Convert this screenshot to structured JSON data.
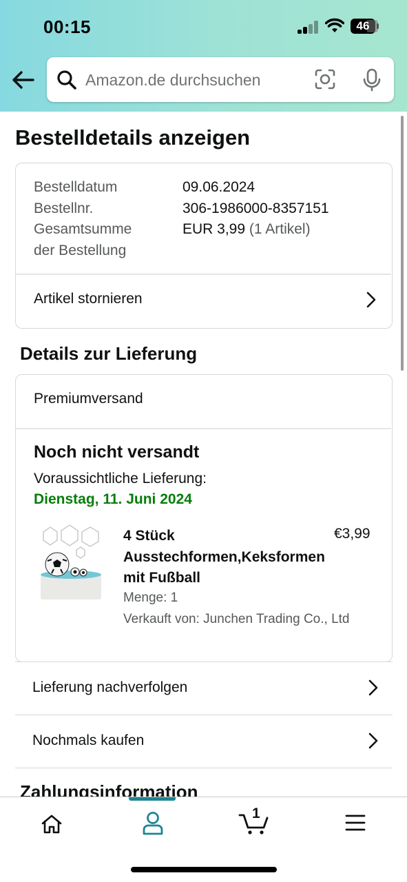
{
  "status_bar": {
    "time": "00:15",
    "battery": "46"
  },
  "search": {
    "placeholder": "Amazon.de durchsuchen"
  },
  "page_title": "Bestelldetails anzeigen",
  "order_summary": {
    "labels": [
      "Bestelldatum",
      "Bestellnr.",
      "Gesamtsumme",
      "der Bestellung"
    ],
    "values": [
      "09.06.2024",
      "306-1986000-8357151",
      "EUR 3,99"
    ],
    "items_note": "(1 Artikel)",
    "cancel_label": "Artikel stornieren"
  },
  "delivery": {
    "section_title": "Details zur Lieferung",
    "shipping_method": "Premiumversand",
    "status": "Noch nicht versandt",
    "estimate_label": "Voraussichtliche Lieferung:",
    "estimate_date": "Dienstag, 11. Juni 2024",
    "item": {
      "name": "4 Stück Ausstechformen,Keksformen mit Fußball",
      "price": "€3,99",
      "quantity": "Menge: 1",
      "seller": "Verkauft von: Junchen Trading Co., Ltd"
    }
  },
  "actions": {
    "track": "Lieferung nachverfolgen",
    "buy_again": "Nochmals kaufen"
  },
  "payment_section_title": "Zahlungsinformation",
  "tabbar": {
    "cart_count": "1",
    "active_tab": "account"
  },
  "colors": {
    "accent_teal": "#1a8695",
    "delivery_green": "#067d0a",
    "header_gradient_start": "#86d9e0",
    "header_gradient_end": "#a6e6cf"
  }
}
